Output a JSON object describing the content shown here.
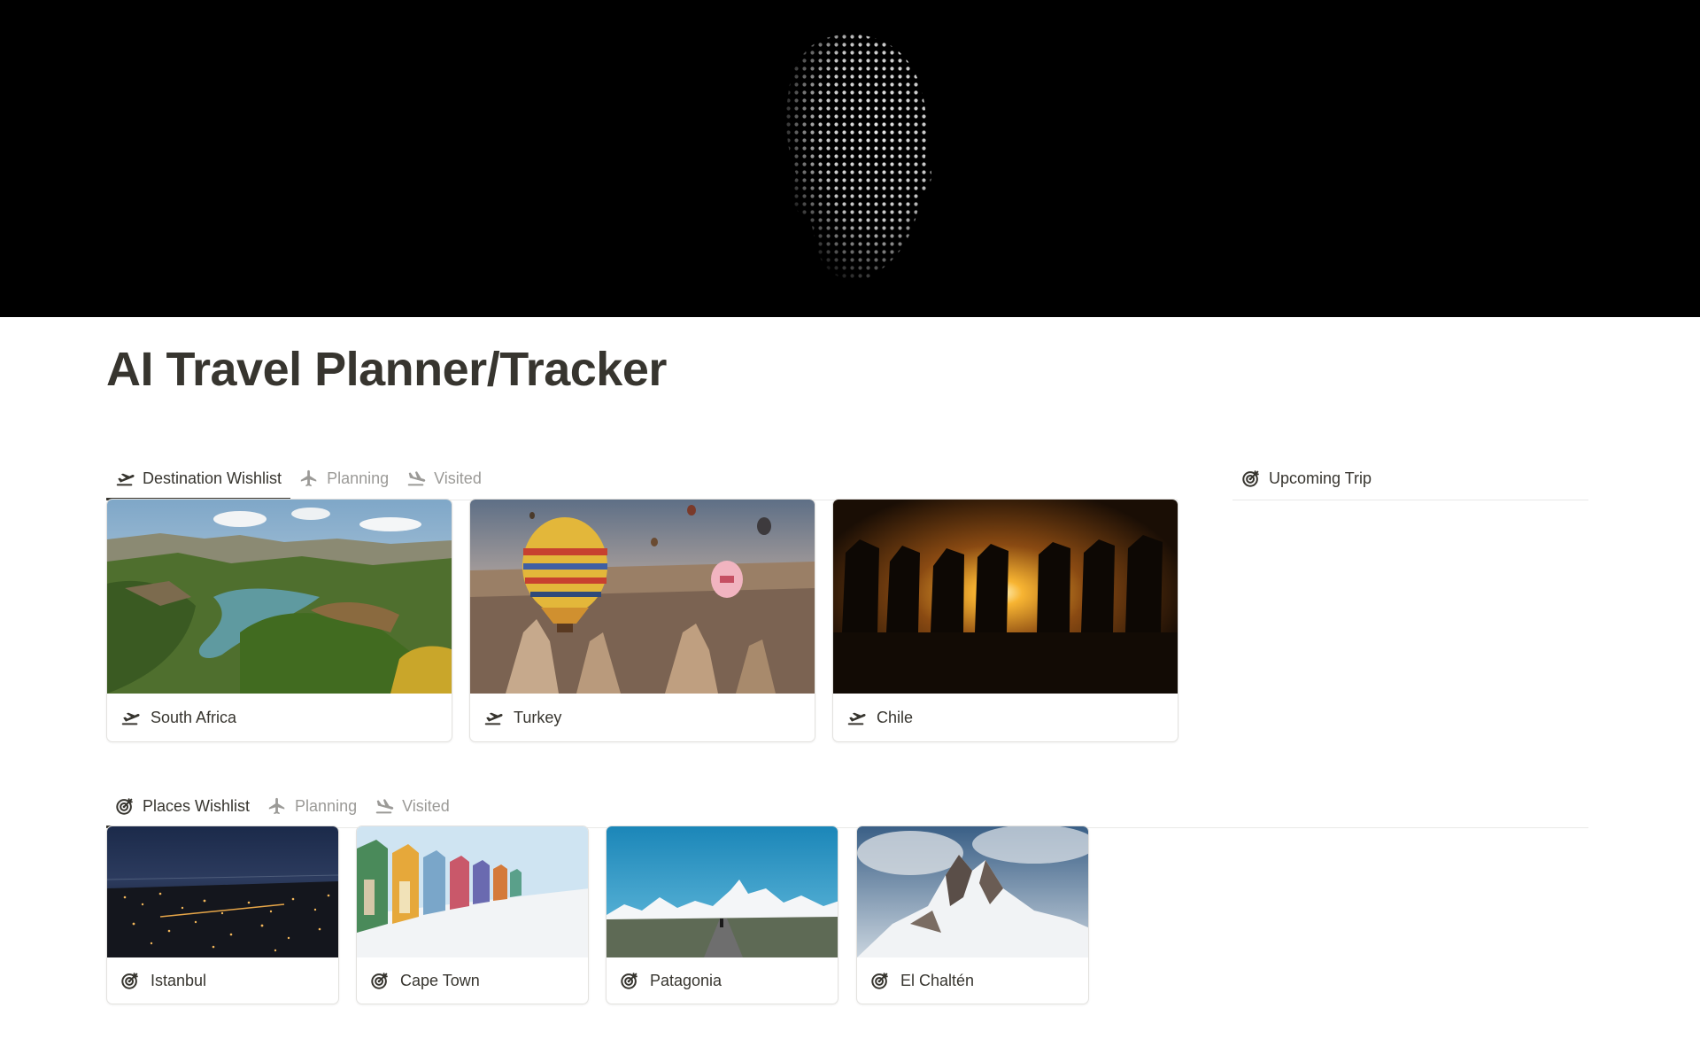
{
  "page": {
    "title": "AI Travel Planner/Tracker"
  },
  "destinations": {
    "tabs": [
      {
        "label": "Destination Wishlist",
        "icon": "plane-takeoff-icon",
        "active": true
      },
      {
        "label": "Planning",
        "icon": "plane-icon",
        "active": false
      },
      {
        "label": "Visited",
        "icon": "plane-landing-icon",
        "active": false
      }
    ],
    "cards": [
      {
        "name": "South Africa",
        "icon": "plane-takeoff-icon"
      },
      {
        "name": "Turkey",
        "icon": "plane-takeoff-icon"
      },
      {
        "name": "Chile",
        "icon": "plane-takeoff-icon"
      }
    ]
  },
  "upcoming": {
    "tab_label": "Upcoming Trip",
    "icon": "target-icon"
  },
  "places": {
    "tabs": [
      {
        "label": "Places Wishlist",
        "icon": "target-icon",
        "active": true
      },
      {
        "label": "Planning",
        "icon": "plane-icon",
        "active": false
      },
      {
        "label": "Visited",
        "icon": "plane-landing-icon",
        "active": false
      }
    ],
    "cards": [
      {
        "name": "Istanbul",
        "icon": "target-icon"
      },
      {
        "name": "Cape Town",
        "icon": "target-icon"
      },
      {
        "name": "Patagonia",
        "icon": "target-icon"
      },
      {
        "name": "El Chaltén",
        "icon": "target-icon"
      }
    ]
  },
  "colors": {
    "text": "#37352f",
    "muted": "#9b9a97",
    "divider": "#e9e9e7",
    "cover": "#000000"
  }
}
